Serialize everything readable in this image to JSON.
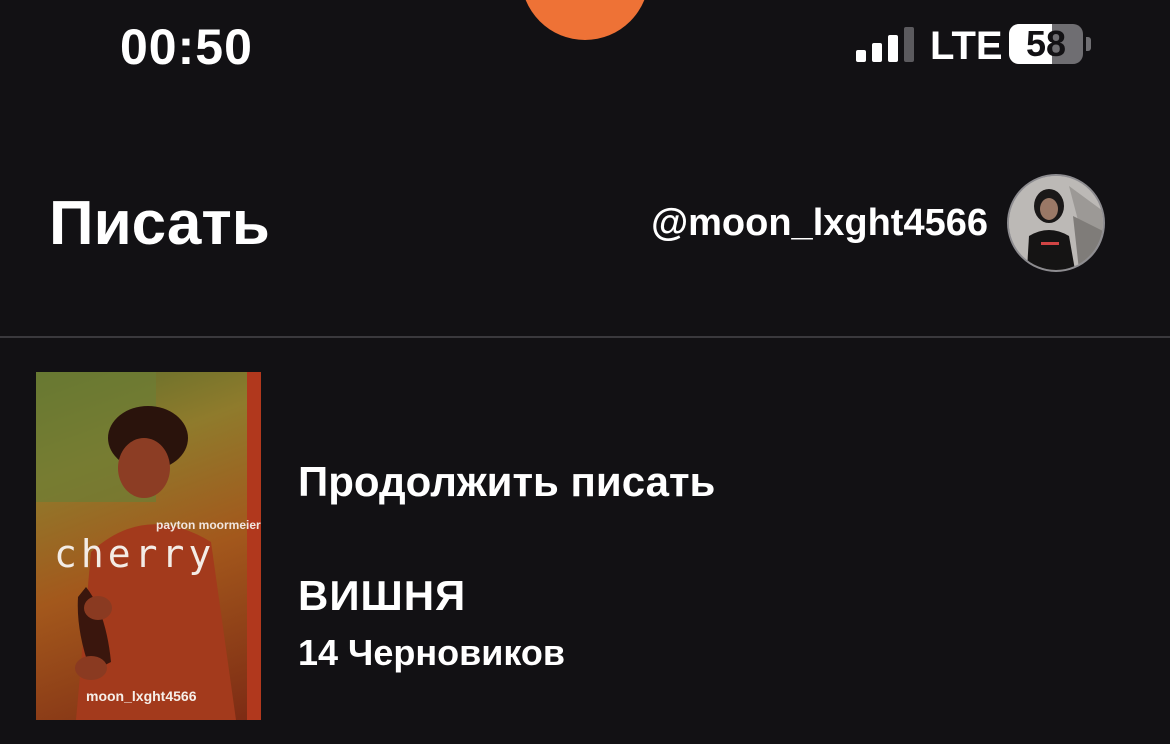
{
  "status_bar": {
    "time": "00:50",
    "network": "LTE",
    "battery": "58",
    "battery_level": 0.58,
    "signal_bars_active": 3,
    "island_color": "#ee7236"
  },
  "header": {
    "title": "Писать",
    "username": "@moon_lxght4566"
  },
  "story_card": {
    "cover": {
      "author": "payton moormeier",
      "title": "cherry",
      "username": "moon_lxght4566"
    },
    "continue_label": "Продолжить писать",
    "story_title": "ВИШНЯ",
    "drafts": "14 Черновиков"
  },
  "colors": {
    "background": "#121114",
    "divider": "#3a393d",
    "accent": "#ee7236"
  }
}
